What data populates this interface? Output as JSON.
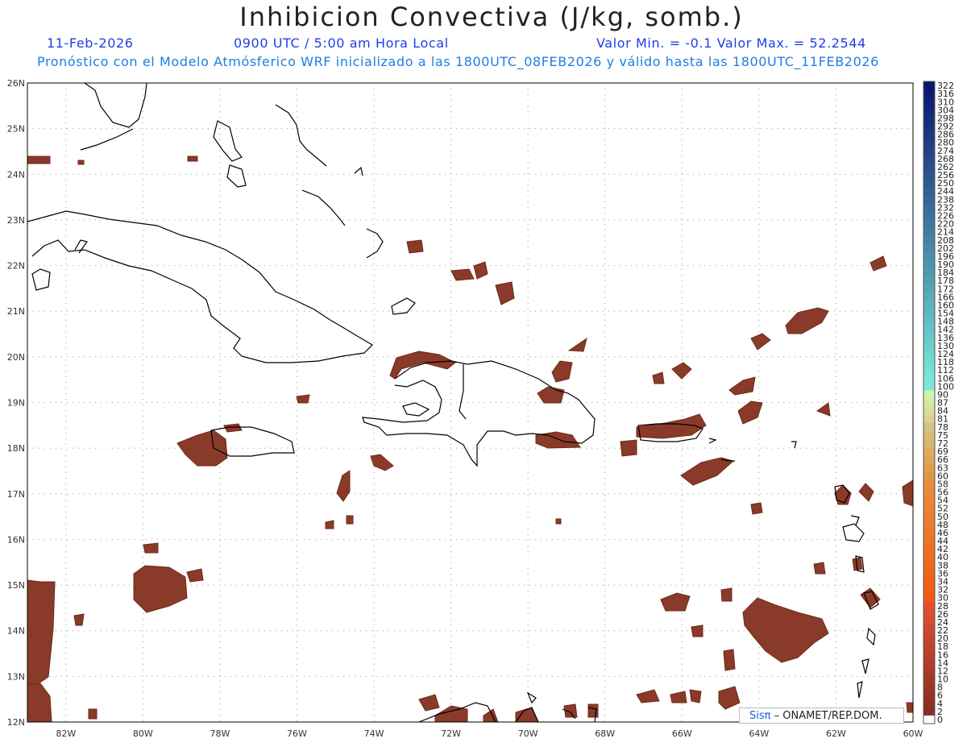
{
  "header": {
    "title": "Inhibicion Convectiva (J/kg, somb.)",
    "date": "11-Feb-2026",
    "time": "0900 UTC / 5:00 am Hora Local",
    "minmax": "Valor Min. = -0.1  Valor Max. = 52.2544",
    "model_info": "Pronóstico con el Modelo Atmósferico WRF inicializado a las 1800UTC_08FEB2026 y válido hasta las  1800UTC_11FEB2026"
  },
  "map": {
    "lat_labels": [
      "26N",
      "25N",
      "24N",
      "23N",
      "22N",
      "21N",
      "20N",
      "19N",
      "18N",
      "17N",
      "16N",
      "15N",
      "14N",
      "13N",
      "12N"
    ],
    "lon_labels": [
      "82W",
      "80W",
      "78W",
      "76W",
      "74W",
      "72W",
      "70W",
      "68W",
      "66W",
      "64W",
      "62W",
      "60W"
    ],
    "lat_range": [
      12,
      26
    ],
    "lon_range": [
      -83,
      -60
    ],
    "grid": "dotted",
    "shading_color": "#8a3a28"
  },
  "colorbar": {
    "labels": [
      "322",
      "316",
      "310",
      "304",
      "298",
      "292",
      "286",
      "280",
      "274",
      "268",
      "262",
      "256",
      "250",
      "244",
      "238",
      "232",
      "226",
      "220",
      "214",
      "208",
      "202",
      "196",
      "190",
      "184",
      "178",
      "172",
      "166",
      "160",
      "154",
      "148",
      "142",
      "136",
      "130",
      "124",
      "118",
      "112",
      "106",
      "100",
      "90",
      "87",
      "84",
      "81",
      "78",
      "75",
      "72",
      "69",
      "66",
      "63",
      "60",
      "58",
      "56",
      "54",
      "52",
      "50",
      "48",
      "46",
      "44",
      "42",
      "40",
      "38",
      "36",
      "34",
      "32",
      "30",
      "28",
      "26",
      "24",
      "22",
      "20",
      "18",
      "16",
      "14",
      "12",
      "10",
      "8",
      "6",
      "4",
      "2",
      "0"
    ]
  },
  "credit": {
    "brand": "Sisπ",
    "text": "– ONAMET/REP.DOM."
  }
}
